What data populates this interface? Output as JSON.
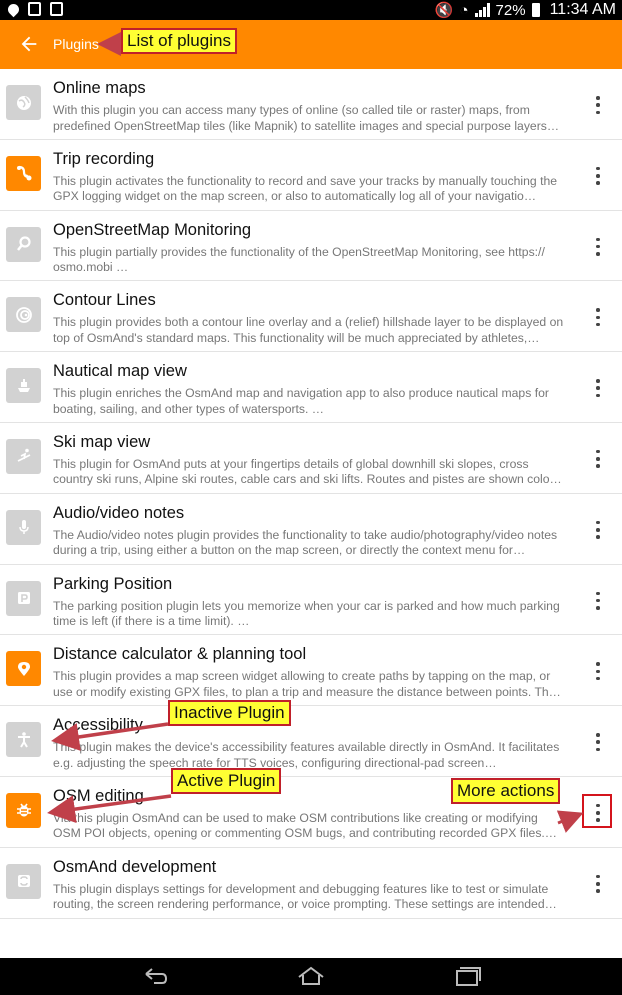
{
  "status_bar": {
    "battery": "72%",
    "time": "11:34 AM"
  },
  "toolbar": {
    "title": "Plugins"
  },
  "plugins": [
    {
      "title": "Online maps",
      "description": "With this plugin you can access many types of online (so called tile or raster) maps, from predefined OpenStreetMap tiles (like Mapnik) to satellite images and special purpose layers…",
      "state": "inactive",
      "icon": "globe-icon"
    },
    {
      "title": "Trip recording",
      "description": "This plugin activates the functionality to record and save your tracks by manually touching the GPX logging widget on the map screen, or also to automatically log all of your navigatio…",
      "state": "active",
      "icon": "trip-recording-icon"
    },
    {
      "title": "OpenStreetMap Monitoring",
      "description": "This plugin partially provides the functionality of the OpenStreetMap Monitoring, see https:// osmo.mobi …",
      "state": "inactive",
      "icon": "monitoring-icon"
    },
    {
      "title": "Contour Lines",
      "description": "This plugin provides both a contour line overlay and a (relief) hillshade layer to be displayed on top of OsmAnd's standard maps. This functionality will be much appreciated by athletes,…",
      "state": "inactive",
      "icon": "contour-icon"
    },
    {
      "title": "Nautical map view",
      "description": "This plugin enriches the OsmAnd map and navigation app to also produce nautical maps for boating, sailing, and other types of watersports. …",
      "state": "inactive",
      "icon": "ship-icon"
    },
    {
      "title": "Ski map view",
      "description": "This plugin for OsmAnd puts at your fingertips details of global downhill ski slopes, cross country ski runs, Alpine ski routes, cable cars and ski lifts. Routes and pistes are shown colo…",
      "state": "inactive",
      "icon": "skier-icon"
    },
    {
      "title": "Audio/video notes",
      "description": "The Audio/video notes plugin provides the functionality to take audio/photography/video notes during a trip, using either a button on the map screen, or directly the context menu for…",
      "state": "inactive",
      "icon": "microphone-icon"
    },
    {
      "title": "Parking Position",
      "description": "The parking position plugin lets you memorize when your car is parked and how much parking time is left (if there is a time limit). …",
      "state": "inactive",
      "icon": "parking-icon"
    },
    {
      "title": "Distance calculator & planning tool",
      "description": "This plugin provides a map screen widget allowing to create paths by tapping on the map, or use or modify existing GPX files, to plan a trip and measure the distance between points. Th…",
      "state": "active",
      "icon": "location-pin-icon"
    },
    {
      "title": "Accessibility",
      "description": "This plugin makes the device's accessibility features available directly in OsmAnd. It facilitates e.g. adjusting the speech rate for TTS voices, configuring directional-pad screen…",
      "state": "inactive",
      "icon": "accessibility-icon"
    },
    {
      "title": "OSM editing",
      "description": "Via this plugin OsmAnd can be used to make OSM contributions like creating or modifying OSM POI objects, opening or commenting OSM bugs, and contributing recorded GPX files.…",
      "state": "active",
      "icon": "bug-icon"
    },
    {
      "title": "OsmAnd development",
      "description": "This plugin displays settings for development and debugging features like to test or simulate routing, the screen rendering performance, or voice prompting. These settings are intended…",
      "state": "inactive",
      "icon": "development-icon"
    }
  ],
  "callouts": {
    "list_of_plugins": "List of plugins",
    "inactive_plugin": "Inactive Plugin",
    "active_plugin": "Active Plugin",
    "more_actions": "More actions"
  },
  "colors": {
    "accent": "#ff8800",
    "inactive_icon_bg": "#d2d2d2",
    "callout_bg": "#ffff33",
    "callout_border": "#c0202a"
  }
}
